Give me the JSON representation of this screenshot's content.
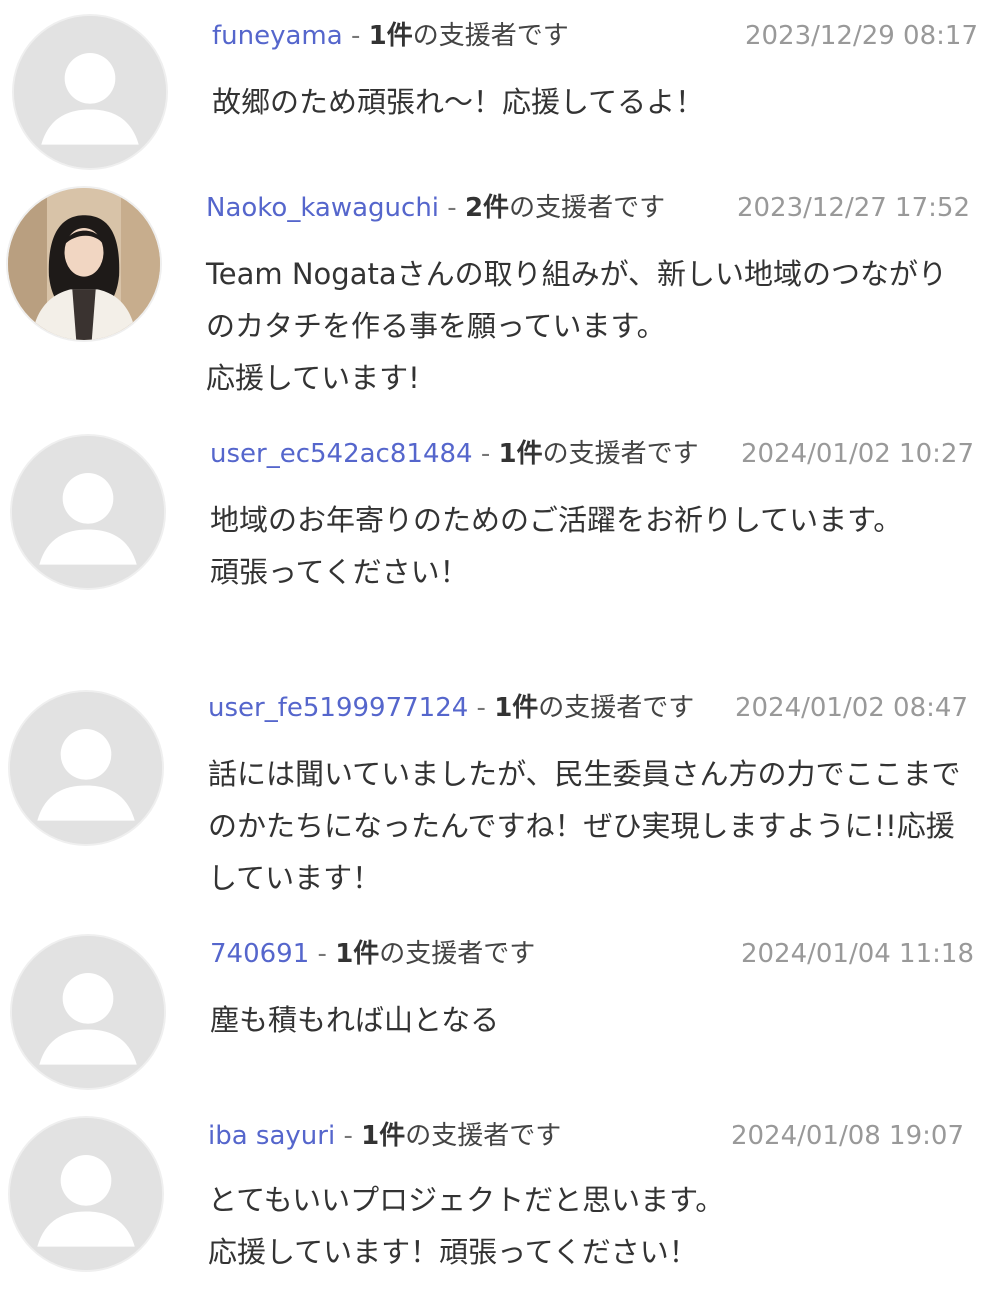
{
  "comments": [
    {
      "username": "funeyama",
      "separator": " - ",
      "count": "1件",
      "suffix": "の支援者です",
      "timestamp": "2023/12/29 08:17",
      "text": "故郷のため頑張れ〜！応援してるよ！",
      "avatar": "default-user-icon"
    },
    {
      "username": "Naoko_kawaguchi",
      "separator": " - ",
      "count": "2件",
      "suffix": "の支援者です",
      "timestamp": "2023/12/27 17:52",
      "text": "Team Nogataさんの取り組みが、新しい地域のつながりのカタチを作る事を願っています。\n応援しています!",
      "avatar": "profile-photo"
    },
    {
      "username": "user_ec542ac81484",
      "separator": " - ",
      "count": "1件",
      "suffix": "の支援者です",
      "timestamp": "2024/01/02 10:27",
      "text": "地域のお年寄りのためのご活躍をお祈りしています。\n頑張ってください！",
      "avatar": "default-user-icon"
    },
    {
      "username": "user_fe5199977124",
      "separator": " - ",
      "count": "1件",
      "suffix": "の支援者です",
      "timestamp": "2024/01/02 08:47",
      "text": "話には聞いていましたが、民生委員さん方の力でここまでのかたちになったんですね！ぜひ実現しますように!!応援しています！",
      "avatar": "default-user-icon"
    },
    {
      "username": "740691",
      "separator": " - ",
      "count": "1件",
      "suffix": "の支援者です",
      "timestamp": "2024/01/04 11:18",
      "text": "塵も積もれば山となる",
      "avatar": "default-user-icon"
    },
    {
      "username": "iba sayuri",
      "separator": " - ",
      "count": "1件",
      "suffix": "の支援者です",
      "timestamp": "2024/01/08 19:07",
      "text": "とてもいいプロジェクトだと思います。\n応援しています！頑張ってください！",
      "avatar": "default-user-icon"
    }
  ]
}
